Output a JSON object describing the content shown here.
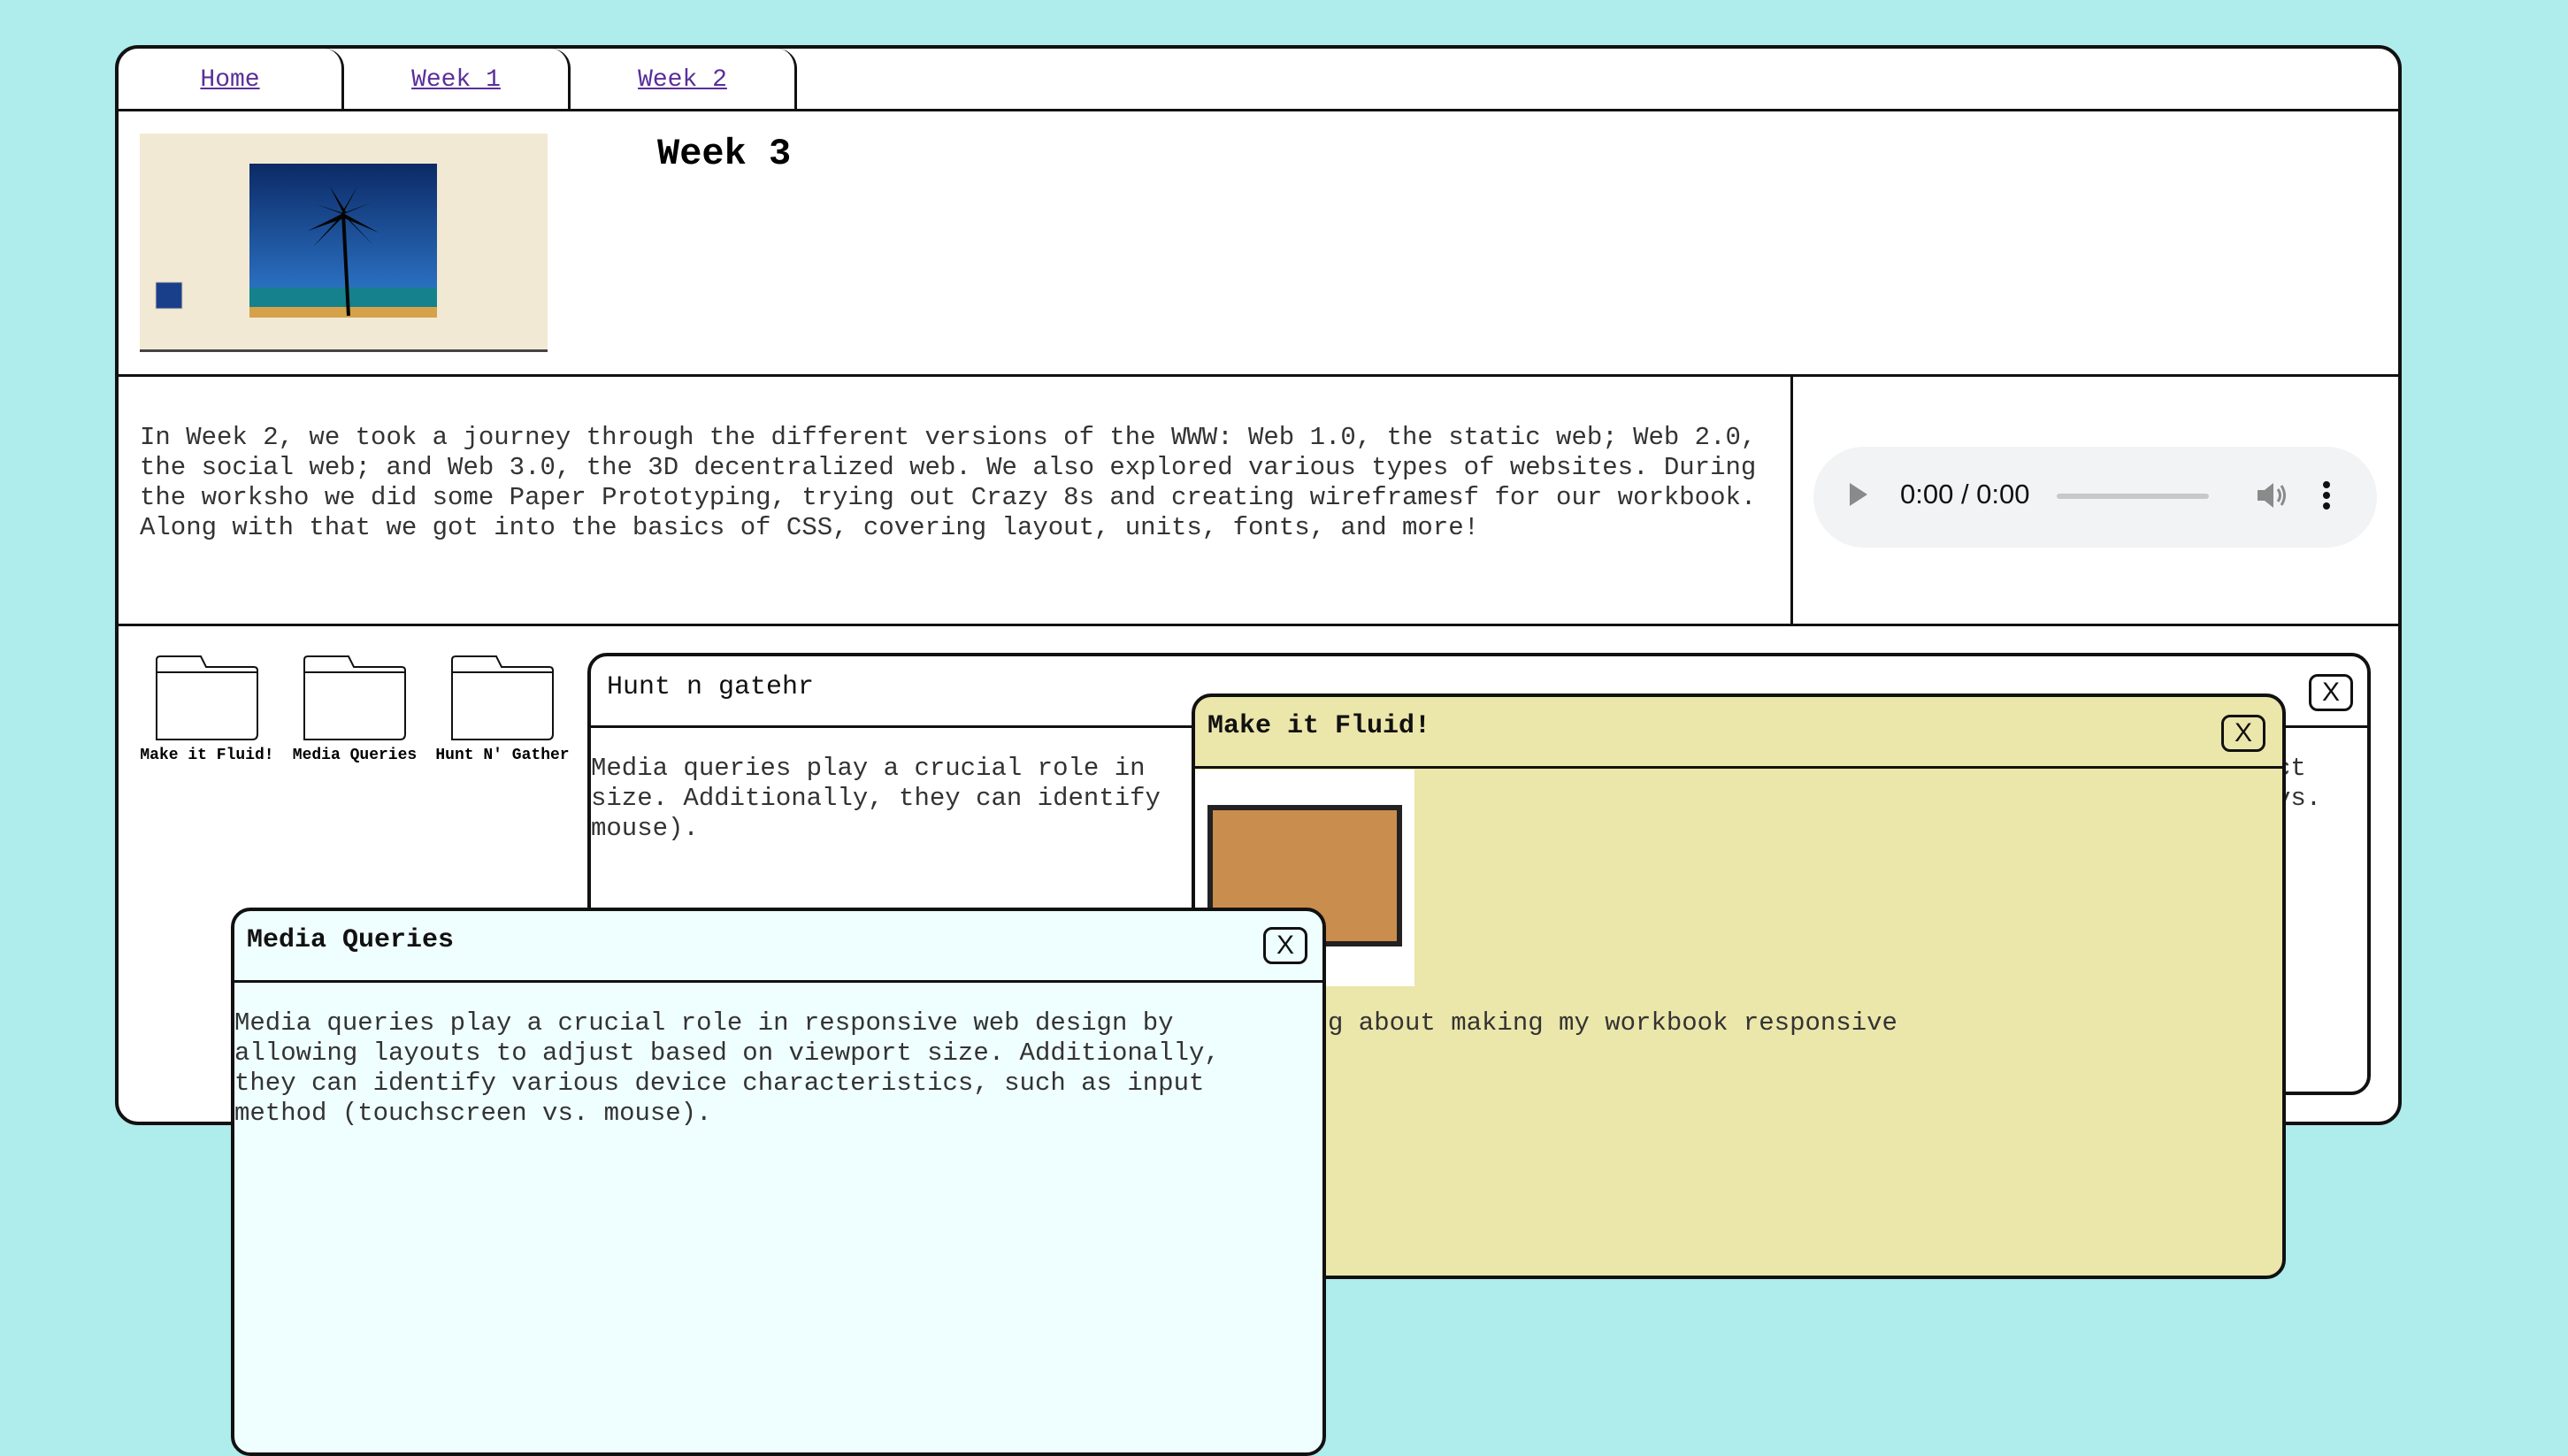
{
  "tabs": [
    {
      "label": "Home"
    },
    {
      "label": "Week 1"
    },
    {
      "label": "Week 2"
    }
  ],
  "page": {
    "title": "Week 3",
    "description": "In Week 2, we took a journey through the different versions of the WWW: Web 1.0, the static web; Web 2.0, the social web; and Web 3.0, the 3D decentralized web. We also explored various types of websites. During the worksho we did some Paper Prototyping, trying out Crazy 8s and creating wireframesf for our workbook. Along with that we got into the basics of CSS, covering layout, units, fonts, and more!"
  },
  "audio": {
    "time": "0:00 / 0:00",
    "icons": [
      "play-icon",
      "volume-icon",
      "more-options-icon"
    ]
  },
  "folders": [
    {
      "label": "Make it Fluid!"
    },
    {
      "label": "Media Queries"
    },
    {
      "label": "Hunt N' Gather"
    }
  ],
  "windows": {
    "hunt": {
      "title": "Hunt n gatehr",
      "close": "X",
      "body_visible_left": "Media queries play a crucial role in\nsize. Additionally, they can identify\nmouse).",
      "body_visible_right": "ct\nvs."
    },
    "fluid": {
      "title": "Make it Fluid!",
      "close": "X",
      "body": "g about making my workbook responsive"
    },
    "media": {
      "title": "Media Queries",
      "close": "X",
      "body": "Media queries play a crucial role in responsive web design by\nallowing layouts to adjust based on viewport size. Additionally,\nthey can identify various device characteristics, such as input\nmethod (touchscreen vs. mouse)."
    }
  },
  "colors": {
    "background": "#afecec",
    "fluid_window": "#ebe6aa",
    "media_window": "#effefe",
    "link": "#5a2f99"
  }
}
